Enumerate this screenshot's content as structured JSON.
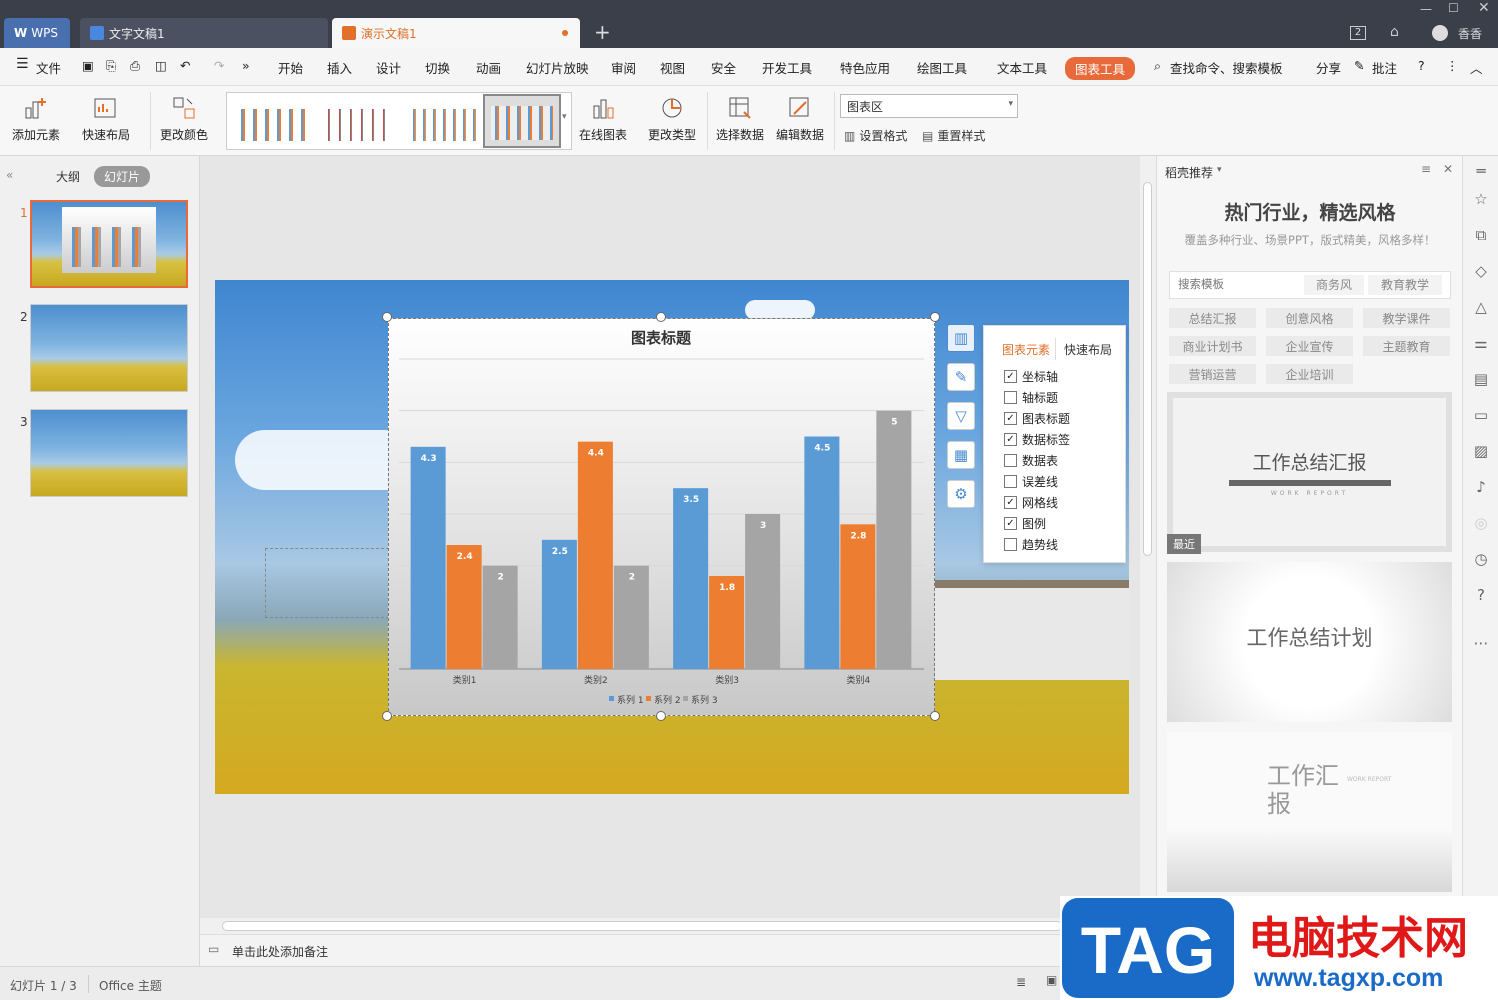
{
  "tabbar": {
    "wps_label": "WPS",
    "tabs": [
      {
        "label": "文字文稿1"
      },
      {
        "label": "演示文稿1"
      }
    ],
    "new_tab": "+",
    "user_name": "香香",
    "counter": "2"
  },
  "menubar": {
    "file": "文件",
    "items": [
      "开始",
      "插入",
      "设计",
      "切换",
      "动画",
      "幻灯片放映",
      "审阅",
      "视图",
      "安全",
      "开发工具",
      "特色应用",
      "绘图工具",
      "文本工具",
      "图表工具"
    ],
    "active": "图表工具",
    "search": "查找命令、搜索模板",
    "share": "分享",
    "comment": "批注",
    "more": "»"
  },
  "ribbon": {
    "add_element": "添加元素",
    "quick_layout": "快速布局",
    "change_color": "更改颜色",
    "online_chart": "在线图表",
    "change_type": "更改类型",
    "select_data": "选择数据",
    "edit_data": "编辑数据",
    "chart_area_select": "图表区",
    "set_format": "设置格式",
    "reset_style": "重置样式"
  },
  "leftpane": {
    "outline_tab": "大纲",
    "slides_tab": "幻灯片",
    "slide_numbers": [
      "1",
      "2",
      "3"
    ]
  },
  "chart_data": {
    "type": "bar",
    "title": "图表标题",
    "categories": [
      "类别1",
      "类别2",
      "类别3",
      "类别4"
    ],
    "series": [
      {
        "name": "系列 1",
        "values": [
          4.3,
          2.5,
          3.5,
          4.5
        ],
        "color": "#5b9bd5"
      },
      {
        "name": "系列 2",
        "values": [
          2.4,
          4.4,
          1.8,
          2.8
        ],
        "color": "#ed7d31"
      },
      {
        "name": "系列 3",
        "values": [
          2,
          2,
          3,
          5
        ],
        "color": "#a5a5a5"
      }
    ],
    "ylim": [
      0,
      6
    ],
    "grid": true,
    "data_labels": true,
    "legend": "bottom"
  },
  "popup": {
    "tab_elements": "图表元素",
    "tab_layout": "快速布局",
    "options": [
      {
        "label": "坐标轴",
        "checked": true
      },
      {
        "label": "轴标题",
        "checked": false
      },
      {
        "label": "图表标题",
        "checked": true
      },
      {
        "label": "数据标签",
        "checked": true
      },
      {
        "label": "数据表",
        "checked": false
      },
      {
        "label": "误差线",
        "checked": false
      },
      {
        "label": "网格线",
        "checked": true
      },
      {
        "label": "图例",
        "checked": true
      },
      {
        "label": "趋势线",
        "checked": false
      }
    ]
  },
  "rightpane": {
    "header": "稻壳推荐",
    "headline": "热门行业，精选风格",
    "subline": "覆盖多种行业、场景PPT，版式精美，风格多样！",
    "search_placeholder": "搜索模板",
    "search_tags": [
      "商务风",
      "教育教学"
    ],
    "tags": [
      "总结汇报",
      "创意风格",
      "教学课件",
      "商业计划书",
      "企业宣传",
      "主题教育",
      "营销运营",
      "企业培训"
    ],
    "templates": [
      {
        "title": "工作总结汇报",
        "sub": "WORK REPORT",
        "badge": "最近"
      },
      {
        "title": "工作总结计划",
        "sub": ""
      },
      {
        "title": "工作汇报",
        "sub": "WORK REPORT"
      }
    ]
  },
  "notes": {
    "placeholder": "单击此处添加备注"
  },
  "status": {
    "slide_info": "幻灯片 1 / 3",
    "theme": "Office 主题"
  },
  "watermark": {
    "logo": "TAG",
    "title": "电脑技术网",
    "url": "www.tagxp.com"
  }
}
